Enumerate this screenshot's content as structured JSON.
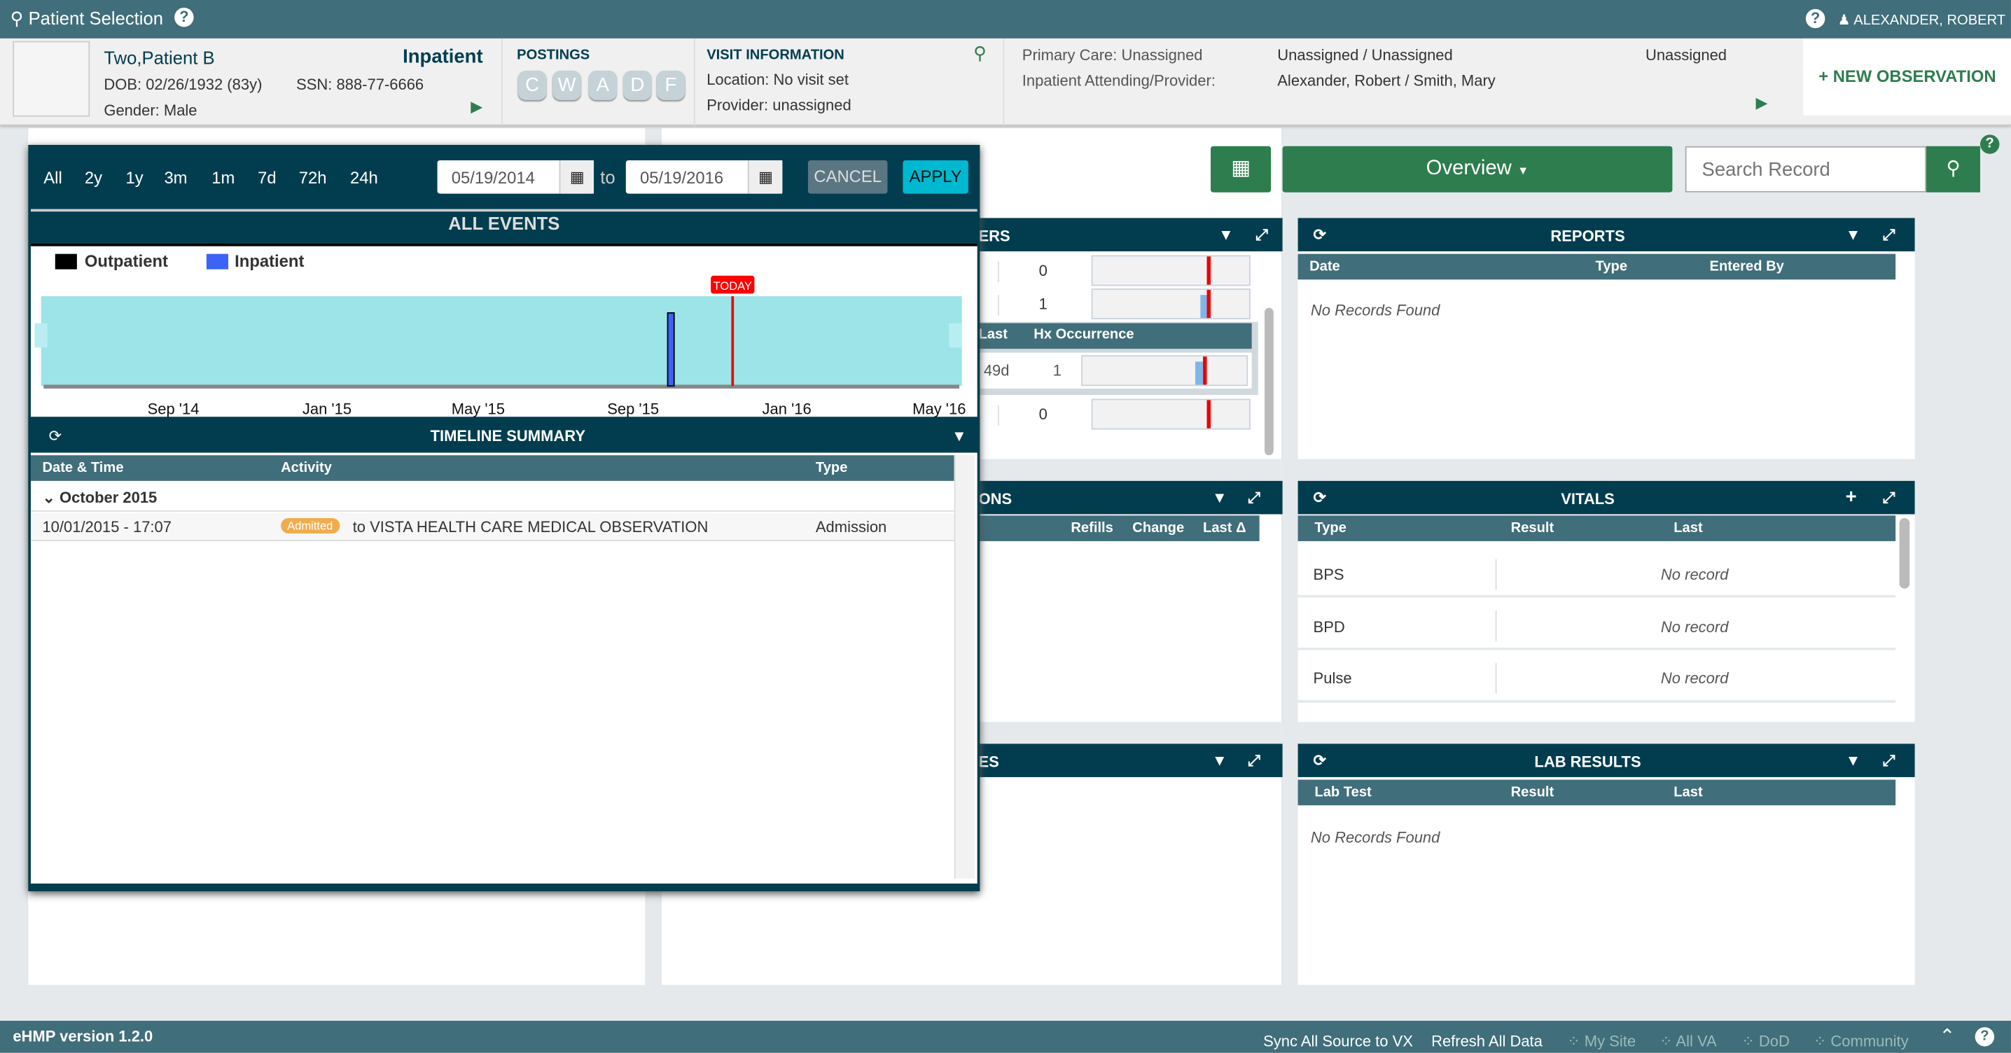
{
  "topbar": {
    "patient_selection": "Patient Selection",
    "user": "ALEXANDER, ROBERT"
  },
  "patient": {
    "name": "Two,Patient B",
    "status": "Inpatient",
    "dob": "DOB: 02/26/1932 (83y)",
    "ssn": "SSN: 888-77-6666",
    "gender": "Gender: Male"
  },
  "postings": {
    "title": "POSTINGS",
    "items": [
      "C",
      "W",
      "A",
      "D",
      "F"
    ]
  },
  "visit": {
    "title": "VISIT INFORMATION",
    "location": "Location: No visit set",
    "provider": "Provider: unassigned"
  },
  "care": {
    "primary_label": "Primary Care: Unassigned",
    "primary_value": "Unassigned / Unassigned",
    "primary_extra": "Unassigned",
    "inpatient_label": "Inpatient Attending/Provider:",
    "inpatient_value": "Alexander, Robert / Smith, Mary"
  },
  "new_observation": "+ NEW OBSERVATION",
  "toolbar": {
    "overview": "Overview",
    "search_placeholder": "Search Record"
  },
  "timeline": {
    "ranges": [
      "All",
      "2y",
      "1y",
      "3m",
      "1m",
      "7d",
      "72h",
      "24h"
    ],
    "from": "05/19/2014",
    "to_label": "to",
    "to": "05/19/2016",
    "cancel": "CANCEL",
    "apply": "APPLY",
    "title": "ALL EVENTS",
    "today": "TODAY",
    "summary_title": "TIMELINE SUMMARY",
    "columns": [
      "Date & Time",
      "Activity",
      "Type"
    ],
    "group": "October 2015",
    "rows": [
      {
        "date": "10/01/2015 - 17:07",
        "badge": "Admitted",
        "activity": "to VISTA HEALTH CARE MEDICAL OBSERVATION",
        "type": "Admission"
      }
    ]
  },
  "chart_data": {
    "type": "bar",
    "legend": [
      {
        "name": "Outpatient",
        "color": "#000000"
      },
      {
        "name": "Inpatient",
        "color": "#3d63f5"
      }
    ],
    "legend_position": "top-left",
    "xlim": [
      "2014-05-19",
      "2016-05-19"
    ],
    "x_ticks": [
      {
        "date": "2014-09-01",
        "label": "Sep '14"
      },
      {
        "date": "2015-01-01",
        "label": "Jan '15"
      },
      {
        "date": "2015-05-01",
        "label": "May '15"
      },
      {
        "date": "2015-09-01",
        "label": "Sep '15"
      },
      {
        "date": "2016-01-01",
        "label": "Jan '16"
      },
      {
        "date": "2016-05-01",
        "label": "May '16"
      }
    ],
    "series": [
      {
        "name": "Inpatient",
        "events": [
          {
            "date": "2015-10-01",
            "count": 1
          }
        ]
      }
    ],
    "today_marker": "2015-11-19",
    "background": "#9ce4e7"
  },
  "encounters": {
    "title_fragment": "ERS",
    "rows": [
      "0",
      "1",
      "0"
    ],
    "sub_headers": [
      "Last",
      "Hx Occurrence"
    ],
    "sub_row": {
      "last": "49d",
      "count": "1"
    }
  },
  "meds": {
    "title_fragment": "ONS",
    "columns": [
      "Refills",
      "Change",
      "Last Δ"
    ]
  },
  "third": {
    "title_fragment": "ES"
  },
  "reports": {
    "title": "REPORTS",
    "columns": [
      "Date",
      "Type",
      "Entered By"
    ],
    "empty": "No Records Found"
  },
  "vitals": {
    "title": "VITALS",
    "columns": [
      "Type",
      "Result",
      "Last"
    ],
    "rows": [
      {
        "type": "BPS",
        "result": "No record"
      },
      {
        "type": "BPD",
        "result": "No record"
      },
      {
        "type": "Pulse",
        "result": "No record"
      }
    ]
  },
  "labs": {
    "title": "LAB RESULTS",
    "columns": [
      "Lab Test",
      "Result",
      "Last"
    ],
    "empty": "No Records Found"
  },
  "footer": {
    "version": "eHMP version 1.2.0",
    "sync": "Sync All Source to VX",
    "refresh": "Refresh All Data",
    "sources": [
      "My Site",
      "All VA",
      "DoD",
      "Community"
    ]
  }
}
